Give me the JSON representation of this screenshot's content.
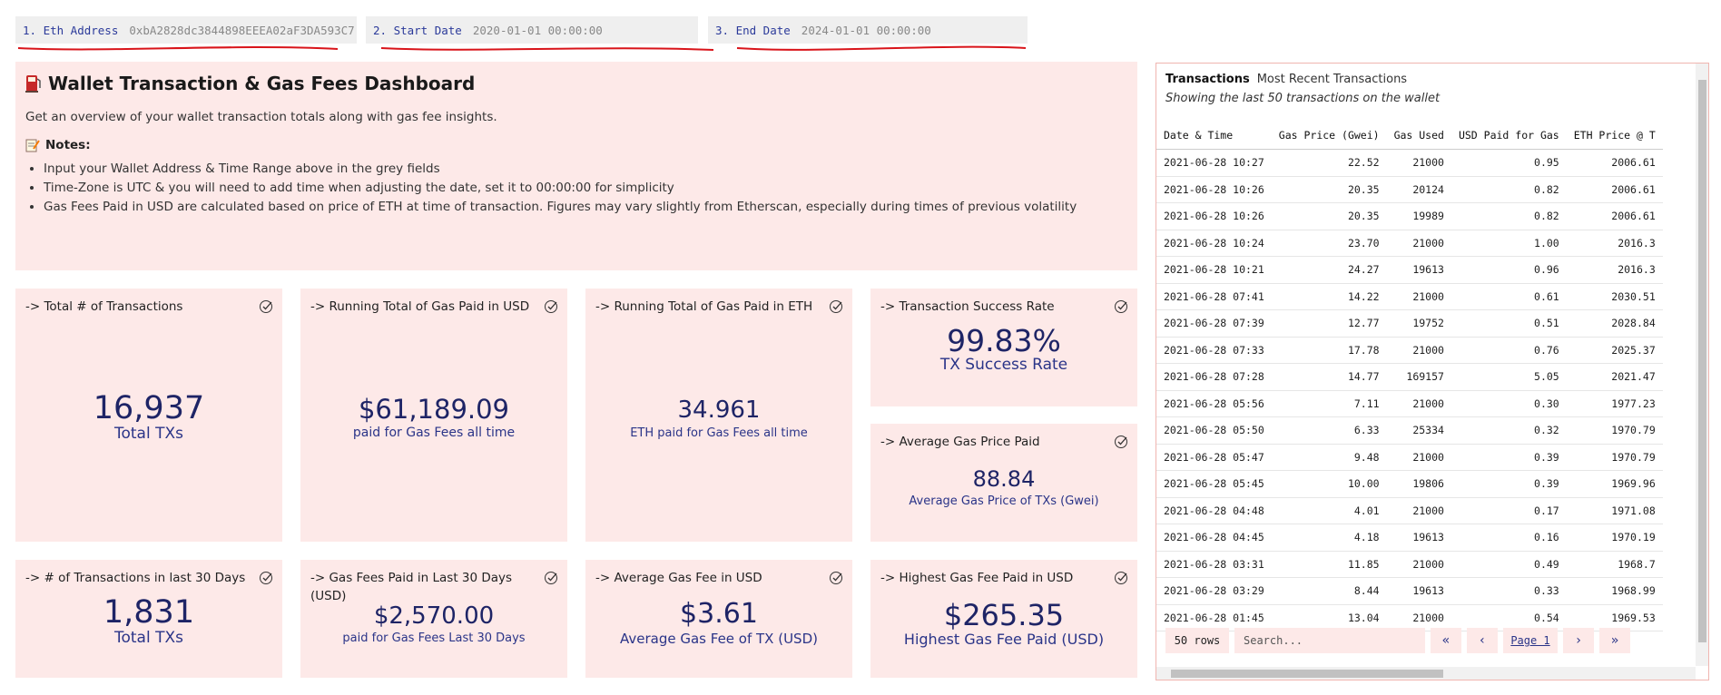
{
  "params": [
    {
      "label": "1. Eth Address",
      "value": "0xbA2828dc3844898EEEA02aF3DA593C7"
    },
    {
      "label": "2. Start Date",
      "value": "2020-01-01 00:00:00"
    },
    {
      "label": "3. End Date",
      "value": "2024-01-01 00:00:00"
    }
  ],
  "intro": {
    "icon": "fuel-pump-icon",
    "title": "Wallet Transaction & Gas Fees Dashboard",
    "subtitle": "Get an overview of your wallet transaction totals along with gas fee insights.",
    "notes_icon": "memo-icon",
    "notes_label": "Notes:",
    "bullets": [
      "Input your Wallet Address & Time Range above in the grey fields",
      "Time-Zone is UTC & you will need to add time when adjusting the date, set it to 00:00:00 for simplicity",
      "Gas Fees Paid in USD are calculated based on price of ETH at time of transaction. Figures may vary slightly from Etherscan, especially during times of previous volatility"
    ]
  },
  "cards": {
    "total_tx": {
      "title": "->  Total # of Transactions",
      "value": "16,937",
      "caption": "Total TXs"
    },
    "gas_usd": {
      "title": "->  Running Total of Gas Paid in USD",
      "value": "$61,189.09",
      "caption": "paid for Gas Fees all time"
    },
    "gas_eth": {
      "title": "->  Running Total of Gas Paid in ETH",
      "value": "34.961",
      "caption": "ETH paid for Gas Fees all time"
    },
    "success": {
      "title": "->  Transaction Success Rate",
      "value": "99.83%",
      "caption": "TX Success Rate"
    },
    "avg_price": {
      "title": "->  Average Gas Price Paid",
      "value": "88.84",
      "caption": "Average Gas Price of TXs (Gwei)"
    },
    "tx_30": {
      "title": "->  # of Transactions in last 30 Days",
      "value": "1,831",
      "caption": "Total TXs"
    },
    "fees_30": {
      "title": "->  Gas Fees Paid in Last 30 Days (USD)",
      "value": "$2,570.00",
      "caption": "paid for Gas Fees Last 30 Days"
    },
    "avg_fee": {
      "title": "->  Average Gas Fee in USD",
      "value": "$3.61",
      "caption": "Average Gas Fee of TX (USD)"
    },
    "highest": {
      "title": "->  Highest Gas Fee Paid in USD",
      "value": "$265.35",
      "caption": "Highest Gas Fee Paid (USD)"
    }
  },
  "transactions": {
    "title": "Transactions",
    "tab": "Most Recent Transactions",
    "subtitle": "Showing the last 50 transactions on the wallet",
    "columns": [
      "Date & Time",
      "Gas Price (Gwei)",
      "Gas Used",
      "USD Paid for Gas",
      "ETH Price @ T"
    ],
    "rows": [
      [
        "2021-06-28 10:27",
        "22.52",
        "21000",
        "0.95",
        "2006.61"
      ],
      [
        "2021-06-28 10:26",
        "20.35",
        "20124",
        "0.82",
        "2006.61"
      ],
      [
        "2021-06-28 10:26",
        "20.35",
        "19989",
        "0.82",
        "2006.61"
      ],
      [
        "2021-06-28 10:24",
        "23.70",
        "21000",
        "1.00",
        "2016.3"
      ],
      [
        "2021-06-28 10:21",
        "24.27",
        "19613",
        "0.96",
        "2016.3"
      ],
      [
        "2021-06-28 07:41",
        "14.22",
        "21000",
        "0.61",
        "2030.51"
      ],
      [
        "2021-06-28 07:39",
        "12.77",
        "19752",
        "0.51",
        "2028.84"
      ],
      [
        "2021-06-28 07:33",
        "17.78",
        "21000",
        "0.76",
        "2025.37"
      ],
      [
        "2021-06-28 07:28",
        "14.77",
        "169157",
        "5.05",
        "2021.47"
      ],
      [
        "2021-06-28 05:56",
        "7.11",
        "21000",
        "0.30",
        "1977.23"
      ],
      [
        "2021-06-28 05:50",
        "6.33",
        "25334",
        "0.32",
        "1970.79"
      ],
      [
        "2021-06-28 05:47",
        "9.48",
        "21000",
        "0.39",
        "1970.79"
      ],
      [
        "2021-06-28 05:45",
        "10.00",
        "19806",
        "0.39",
        "1969.96"
      ],
      [
        "2021-06-28 04:48",
        "4.01",
        "21000",
        "0.17",
        "1971.08"
      ],
      [
        "2021-06-28 04:45",
        "4.18",
        "19613",
        "0.16",
        "1970.19"
      ],
      [
        "2021-06-28 03:31",
        "11.85",
        "21000",
        "0.49",
        "1968.7"
      ],
      [
        "2021-06-28 03:29",
        "8.44",
        "19613",
        "0.33",
        "1968.99"
      ],
      [
        "2021-06-28 01:45",
        "13.04",
        "21000",
        "0.54",
        "1969.53"
      ]
    ],
    "pager": {
      "rows": "50 rows",
      "search_placeholder": "Search...",
      "page": "Page 1",
      "first": "«",
      "prev": "‹",
      "next": "›",
      "last": "»"
    }
  },
  "colors": {
    "panel": "#fde9e8",
    "accent": "#1e2466",
    "underline": "#d9141a"
  }
}
